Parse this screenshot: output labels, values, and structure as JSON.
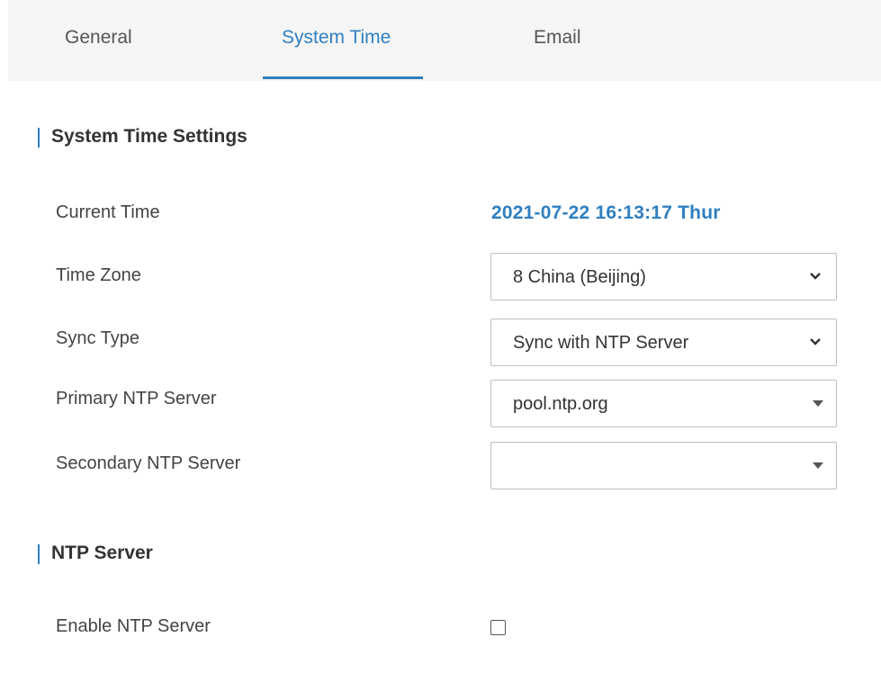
{
  "tabs": {
    "general": "General",
    "system_time": "System Time",
    "email": "Email",
    "active": "System Time"
  },
  "system_time_settings": {
    "title": "System Time Settings",
    "current_time_label": "Current Time",
    "current_time_value": "2021-07-22 16:13:17 Thur",
    "time_zone_label": "Time Zone",
    "time_zone_value": "8 China (Beijing)",
    "sync_type_label": "Sync Type",
    "sync_type_value": "Sync with NTP Server",
    "primary_ntp_label": "Primary NTP Server",
    "primary_ntp_value": "pool.ntp.org",
    "secondary_ntp_label": "Secondary NTP Server",
    "secondary_ntp_value": ""
  },
  "ntp_server": {
    "title": "NTP Server",
    "enable_label": "Enable NTP Server",
    "enabled": false
  },
  "colors": {
    "accent": "#2f7fc1",
    "tabbar_bg": "#f5f5f5"
  }
}
